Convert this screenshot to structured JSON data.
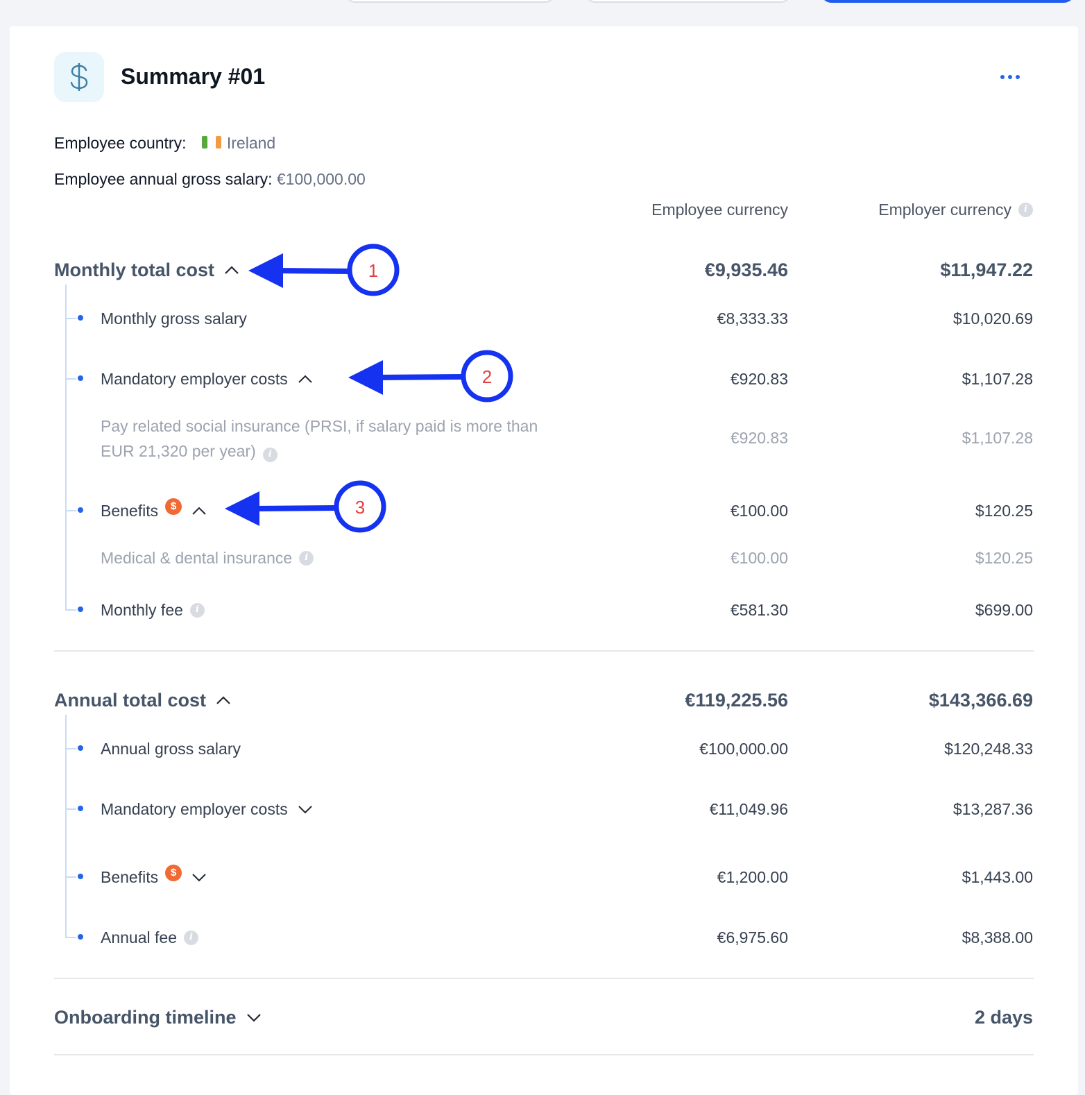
{
  "summary": {
    "title": "Summary #01",
    "icon": "dollar-icon",
    "employee_country_label": "Employee country:",
    "employee_country_value": "Ireland",
    "annual_salary_label": "Employee annual gross salary:",
    "annual_salary_value": "€100,000.00"
  },
  "columns": {
    "employee_currency": "Employee currency",
    "employer_currency": "Employer currency"
  },
  "monthly": {
    "title": "Monthly total cost",
    "employee_total": "€9,935.46",
    "employer_total": "$11,947.22",
    "rows": [
      {
        "label": "Monthly gross salary",
        "employee": "€8,333.33",
        "employer": "$10,020.69"
      },
      {
        "label": "Mandatory employer costs",
        "employee": "€920.83",
        "employer": "$1,107.28"
      },
      {
        "label": "Benefits",
        "employee": "€100.00",
        "employer": "$120.25"
      },
      {
        "label": "Monthly fee",
        "employee": "€581.30",
        "employer": "$699.00"
      }
    ],
    "mandatory_detail": {
      "label": "Pay related social insurance (PRSI, if salary paid is more than EUR 21,320 per year)",
      "employee": "€920.83",
      "employer": "$1,107.28"
    },
    "benefits_detail": {
      "label": "Medical & dental insurance",
      "employee": "€100.00",
      "employer": "$120.25"
    }
  },
  "annual": {
    "title": "Annual total cost",
    "employee_total": "€119,225.56",
    "employer_total": "$143,366.69",
    "rows": [
      {
        "label": "Annual gross salary",
        "employee": "€100,000.00",
        "employer": "$120,248.33"
      },
      {
        "label": "Mandatory employer costs",
        "employee": "€11,049.96",
        "employer": "$13,287.36"
      },
      {
        "label": "Benefits",
        "employee": "€1,200.00",
        "employer": "$1,443.00"
      },
      {
        "label": "Annual fee",
        "employee": "€6,975.60",
        "employer": "$8,388.00"
      }
    ]
  },
  "onboarding": {
    "title": "Onboarding timeline",
    "value": "2 days"
  },
  "badges": {
    "currency_badge": "$",
    "info": "i"
  },
  "annotations": {
    "one": "1",
    "two": "2",
    "three": "3"
  },
  "colors": {
    "accent": "#2563eb",
    "annotation": "#1432f0",
    "annotation_text": "#e53e3e",
    "badge": "#f06a35"
  }
}
